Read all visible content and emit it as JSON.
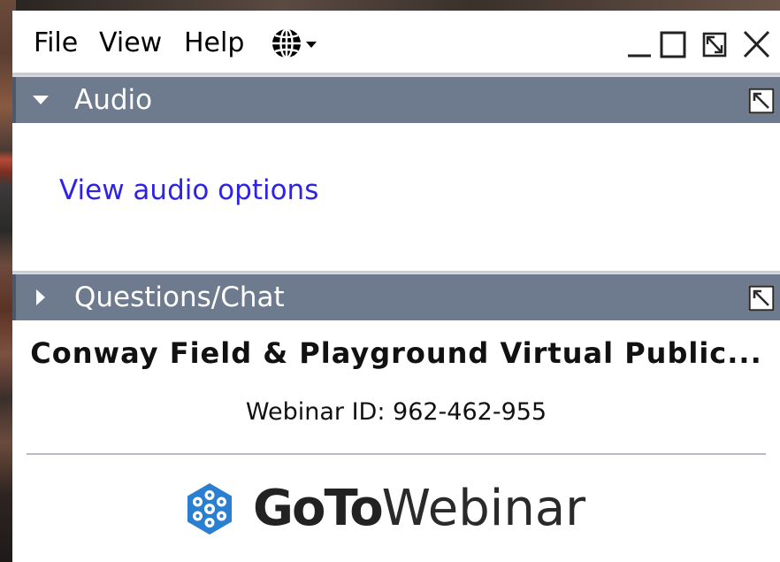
{
  "menu": {
    "items": [
      {
        "label": "File"
      },
      {
        "label": "View"
      },
      {
        "label": "Help"
      }
    ],
    "language_icon": "globe-icon"
  },
  "window_controls": {
    "minimize_icon": "minimize-icon",
    "maximize_icon": "maximize-icon",
    "restore_icon": "restore-icon",
    "close_icon": "close-icon"
  },
  "panels": {
    "audio": {
      "title": "Audio",
      "expanded": true,
      "link_label": "View audio options"
    },
    "chat": {
      "title": "Questions/Chat",
      "expanded": false
    }
  },
  "session": {
    "title": "Conway Field & Playground Virtual Public...",
    "webinar_id": "Webinar ID: 962-462-955"
  },
  "logo": {
    "brand_strong": "GoTo",
    "brand_light": "Webinar",
    "icon": "gotowebinar-logo-icon"
  },
  "colors": {
    "panel_header": "#6e7b8e",
    "link": "#2f22e8",
    "logo_blue": "#2b7fd0"
  }
}
